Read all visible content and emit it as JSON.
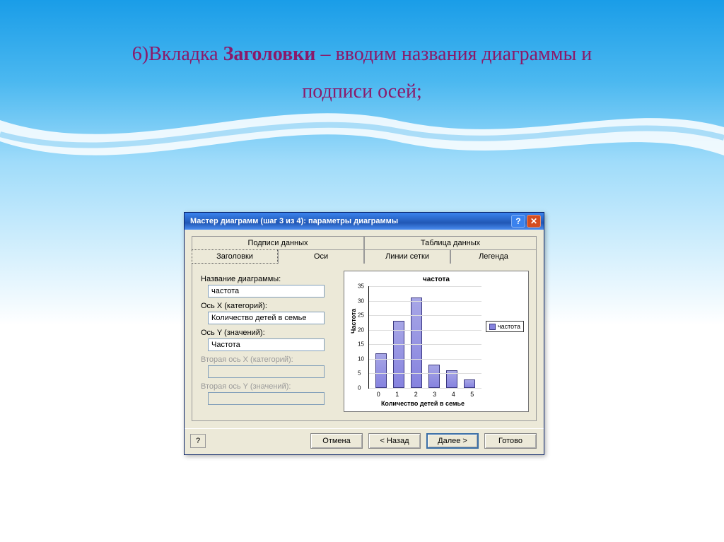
{
  "slide": {
    "line1_prefix": "6)Вкладка ",
    "line1_bold": "Заголовки",
    "line1_suffix": " – вводим названия диаграммы и",
    "line2": "подписи осей;"
  },
  "window": {
    "title": "Мастер диаграмм (шаг 3 из 4): параметры диаграммы"
  },
  "tabs": {
    "top": [
      "Подписи данных",
      "Таблица данных"
    ],
    "bottom": [
      "Заголовки",
      "Оси",
      "Линии сетки",
      "Легенда"
    ]
  },
  "form": {
    "chart_title_label": "Название диаграммы:",
    "chart_title_value": "частота",
    "x_label": "Ось X (категорий):",
    "x_value": "Количество детей в семье",
    "y_label": "Ось Y (значений):",
    "y_value": "Частота",
    "x2_label": "Вторая ось X (категорий):",
    "x2_value": "",
    "y2_label": "Вторая ось Y (значений):",
    "y2_value": ""
  },
  "chart": {
    "title": "частота",
    "ylabel": "Частота",
    "xlabel": "Количество детей в семье",
    "legend_label": "частота"
  },
  "buttons": {
    "help": "?",
    "cancel": "Отмена",
    "back": "< Назад",
    "next": "Далее >",
    "finish": "Готово"
  },
  "chart_data": {
    "type": "bar",
    "categories": [
      "0",
      "1",
      "2",
      "3",
      "4",
      "5"
    ],
    "values": [
      12,
      23,
      31,
      8,
      6,
      3
    ],
    "title": "частота",
    "xlabel": "Количество детей в семье",
    "ylabel": "Частота",
    "ylim": [
      0,
      35
    ],
    "yticks": [
      0,
      5,
      10,
      15,
      20,
      25,
      30,
      35
    ],
    "series": [
      {
        "name": "частота",
        "values": [
          12,
          23,
          31,
          8,
          6,
          3
        ]
      }
    ]
  }
}
